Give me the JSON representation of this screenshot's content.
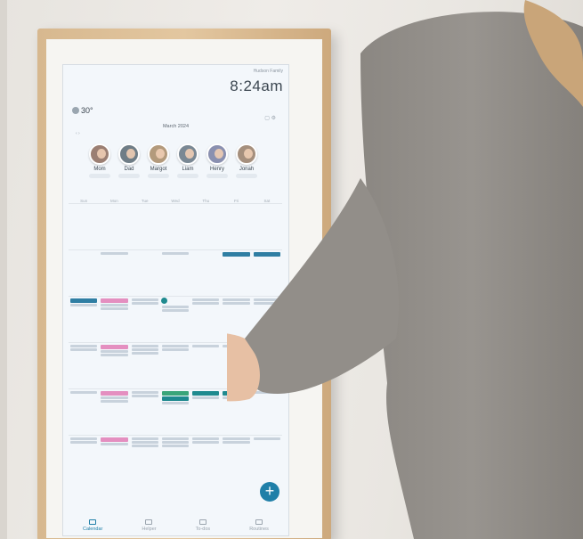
{
  "screen": {
    "status": "Hudson Family",
    "clock": "8:24am",
    "weather": "30°",
    "month": "March 2024"
  },
  "people": [
    {
      "name": "Mom",
      "color": "#9b7f73"
    },
    {
      "name": "Dad",
      "color": "#6f7d86"
    },
    {
      "name": "Margot",
      "color": "#b39a7c"
    },
    {
      "name": "Liam",
      "color": "#7a8894"
    },
    {
      "name": "Henry",
      "color": "#8a90b0"
    },
    {
      "name": "Jonah",
      "color": "#a58f7d"
    }
  ],
  "weekdays": [
    "Sun",
    "Mon",
    "Tue",
    "Wed",
    "Thu",
    "Fri",
    "Sat"
  ],
  "tabs": [
    {
      "label": "Calendar",
      "active": true
    },
    {
      "label": "Helper",
      "active": false
    },
    {
      "label": "To-dos",
      "active": false
    },
    {
      "label": "Routines",
      "active": false
    }
  ],
  "fab": "+",
  "colors": {
    "accent": "#1f7fa8",
    "frame": "#dcbf97",
    "sweater": "#8f8b86"
  }
}
